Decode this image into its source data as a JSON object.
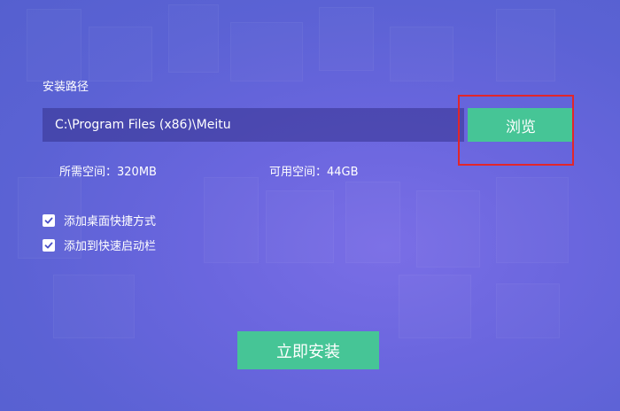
{
  "install_path": {
    "label": "安装路径",
    "value": "C:\\Program Files (x86)\\Meitu",
    "browse_label": "浏览"
  },
  "space": {
    "required": "所需空间：320MB",
    "available": "可用空间：44GB"
  },
  "options": [
    {
      "label": "添加桌面快捷方式",
      "checked": true
    },
    {
      "label": "添加到快速启动栏",
      "checked": true
    }
  ],
  "install_button_label": "立即安装",
  "colors": {
    "accent_green": "#46c596",
    "background": "#6a66de",
    "highlight": "#e2262a"
  }
}
